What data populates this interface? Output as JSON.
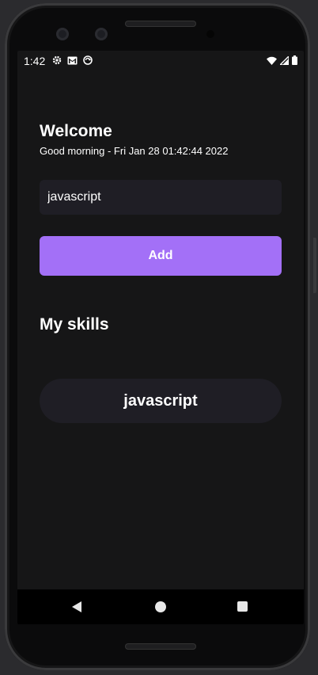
{
  "status_bar": {
    "time": "1:42",
    "left_icons": [
      "gear-icon",
      "gmail-icon",
      "sync-icon"
    ],
    "right_icons": [
      "wifi-icon",
      "signal-icon",
      "battery-icon"
    ]
  },
  "header": {
    "title": "Welcome",
    "greeting": "Good morning - Fri Jan 28 01:42:44 2022"
  },
  "form": {
    "input_value": "javascript",
    "add_label": "Add"
  },
  "skills": {
    "title": "My skills",
    "items": [
      {
        "label": "javascript"
      }
    ]
  },
  "nav": {
    "icons": [
      "back-icon",
      "home-icon",
      "recents-icon"
    ]
  },
  "colors": {
    "background": "#161617",
    "accent": "#a370f7",
    "surface": "#1f1e25",
    "text": "#ffffff"
  }
}
